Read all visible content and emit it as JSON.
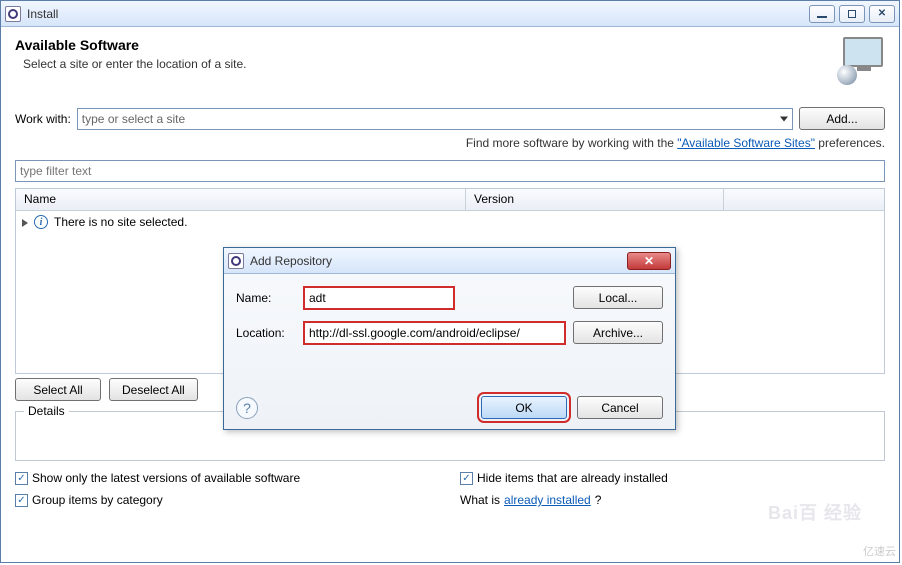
{
  "window": {
    "title": "Install",
    "min_tip": "Minimize",
    "max_tip": "Maximize",
    "close_tip": "Close"
  },
  "header": {
    "title": "Available Software",
    "subtitle": "Select a site or enter the location of a site."
  },
  "workwith": {
    "label": "Work with:",
    "placeholder": "type or select a site",
    "add_btn": "Add..."
  },
  "hint": {
    "prefix": "Find more software by working with the ",
    "link": "\"Available Software Sites\"",
    "suffix": " preferences."
  },
  "filter": {
    "placeholder": "type filter text"
  },
  "table": {
    "col_name": "Name",
    "col_version": "Version",
    "empty_msg": "There is no site selected."
  },
  "buttons": {
    "select_all": "Select All",
    "deselect_all": "Deselect All"
  },
  "details": {
    "legend": "Details"
  },
  "checks": {
    "c1": "Show only the latest versions of available software",
    "c2": "Hide items that are already installed",
    "c3": "Group items by category",
    "c4_prefix": "What is ",
    "c4_link": "already installed",
    "c4_suffix": "?"
  },
  "dialog": {
    "title": "Add Repository",
    "name_label": "Name:",
    "name_value": "adt",
    "location_label": "Location:",
    "location_value": "http://dl-ssl.google.com/android/eclipse/",
    "local_btn": "Local...",
    "archive_btn": "Archive...",
    "ok": "OK",
    "cancel": "Cancel",
    "close_tip": "Close"
  },
  "watermarks": {
    "baidu": "Bai百 经验",
    "yisu": "亿速云"
  }
}
